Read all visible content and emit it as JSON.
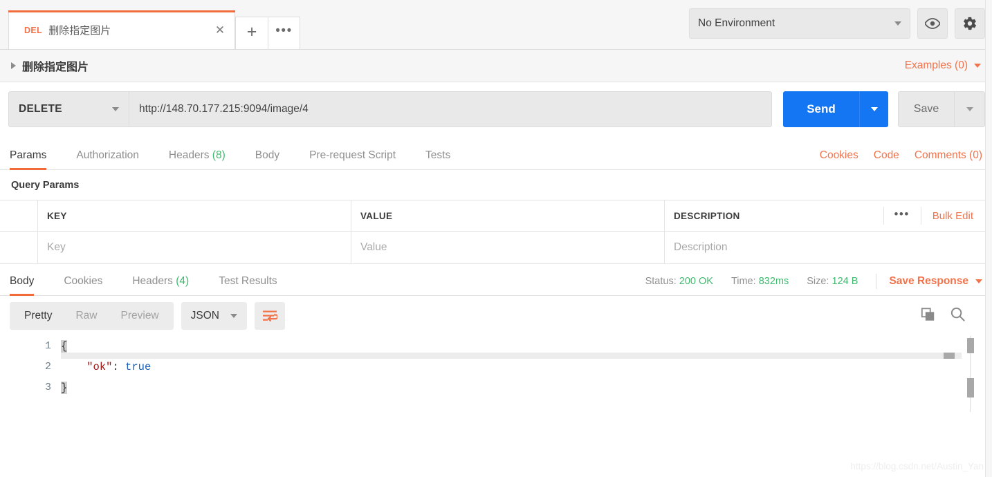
{
  "window": {
    "tabs": [
      {
        "method": "DEL",
        "title": "删除指定图片",
        "close_label": "✕"
      }
    ],
    "new_tab_label": "+",
    "tab_options_label": "•••"
  },
  "environment": {
    "selected": "No Environment",
    "eye_icon": "eye-icon",
    "settings_icon": "gear-icon"
  },
  "request_header": {
    "name": "删除指定图片",
    "examples_label": "Examples (0)"
  },
  "url_bar": {
    "method": "DELETE",
    "url": "http://148.70.177.215:9094/image/4",
    "send_label": "Send",
    "save_label": "Save"
  },
  "request_tabs": [
    {
      "label": "Params",
      "count": "",
      "active": true
    },
    {
      "label": "Authorization",
      "count": "",
      "active": false
    },
    {
      "label": "Headers",
      "count": "(8)",
      "active": false
    },
    {
      "label": "Body",
      "count": "",
      "active": false
    },
    {
      "label": "Pre-request Script",
      "count": "",
      "active": false
    },
    {
      "label": "Tests",
      "count": "",
      "active": false
    }
  ],
  "request_tabs_right": [
    {
      "label": "Cookies"
    },
    {
      "label": "Code"
    },
    {
      "label": "Comments (0)"
    }
  ],
  "query_params": {
    "title": "Query Params",
    "columns": [
      "KEY",
      "VALUE",
      "DESCRIPTION"
    ],
    "options_label": "•••",
    "bulk_edit_label": "Bulk Edit",
    "placeholders": {
      "key": "Key",
      "value": "Value",
      "description": "Description"
    }
  },
  "response_tabs": [
    {
      "label": "Body",
      "count": "",
      "active": true
    },
    {
      "label": "Cookies",
      "count": "",
      "active": false
    },
    {
      "label": "Headers",
      "count": "(4)",
      "active": false
    },
    {
      "label": "Test Results",
      "count": "",
      "active": false
    }
  ],
  "response_meta": {
    "status_label": "Status:",
    "status_value": "200 OK",
    "time_label": "Time:",
    "time_value": "832ms",
    "size_label": "Size:",
    "size_value": "124 B",
    "save_response_label": "Save Response"
  },
  "response_toolbar": {
    "view_modes": [
      {
        "label": "Pretty",
        "active": true
      },
      {
        "label": "Raw",
        "active": false
      },
      {
        "label": "Preview",
        "active": false
      }
    ],
    "format": "JSON",
    "wrap_icon": "word-wrap-icon",
    "copy_icon": "copy-icon",
    "search_icon": "search-icon"
  },
  "response_body": {
    "language": "json",
    "line_numbers": [
      "1",
      "2",
      "3"
    ],
    "lines": [
      {
        "text": "{",
        "type": "brace"
      },
      {
        "text": "    \"ok\": true",
        "type": "pair",
        "key": "\"ok\"",
        "sep": ": ",
        "value": "true",
        "indent": "    "
      },
      {
        "text": "}",
        "type": "brace"
      }
    ]
  },
  "watermark": "https://blog.csdn.net/Austin_Yan",
  "colors": {
    "accent": "#f26b3a",
    "send_blue": "#1476f2",
    "status_green": "#3fba6f",
    "json_key": "#a31515",
    "json_bool": "#1a5fb4"
  }
}
